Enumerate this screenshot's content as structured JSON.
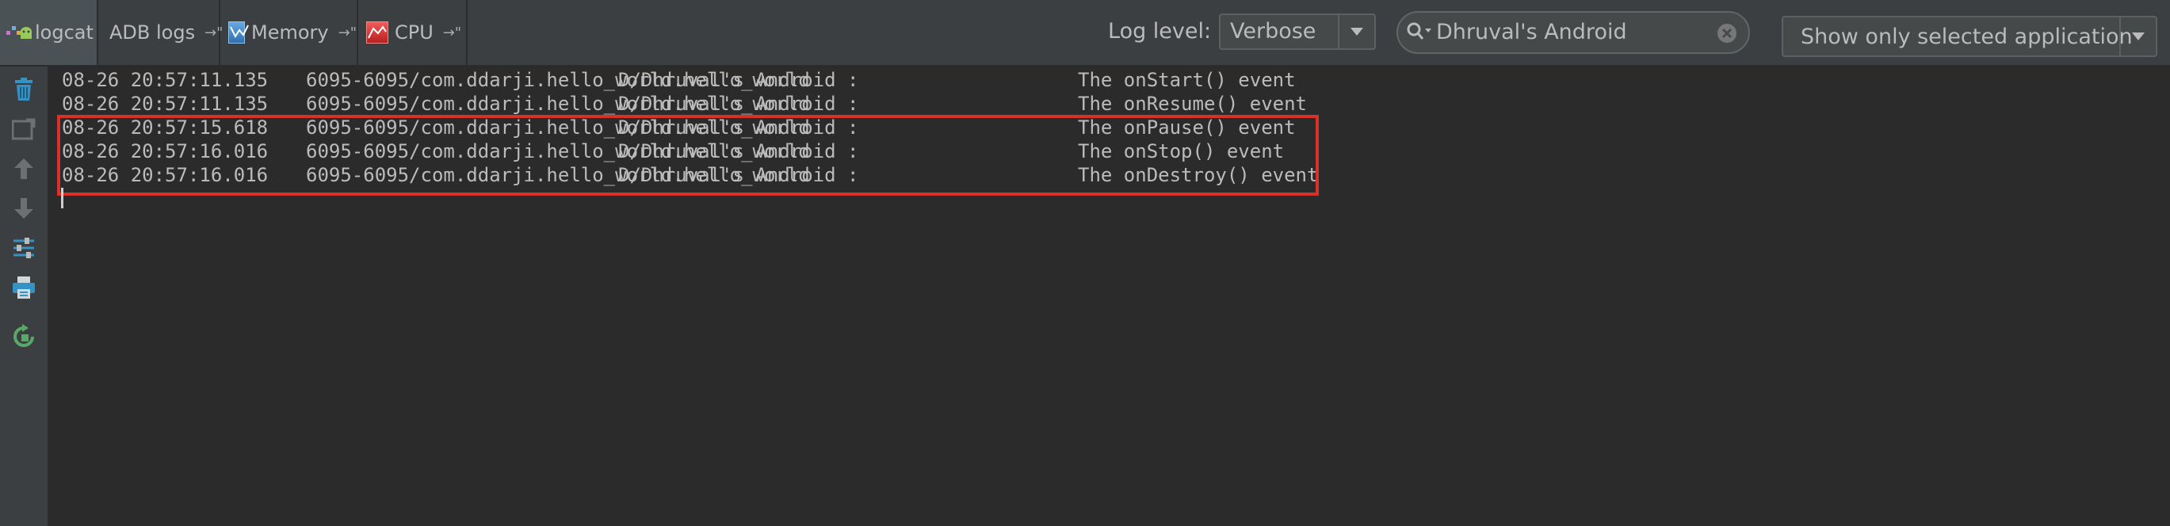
{
  "tabs": [
    {
      "label": "logcat",
      "active": true
    },
    {
      "label": "ADB logs",
      "pin": "→\""
    },
    {
      "label": "Memory",
      "pin": "→\""
    },
    {
      "label": "CPU",
      "pin": "→\""
    }
  ],
  "toolbar": {
    "log_level_label": "Log level:",
    "log_level_value": "Verbose",
    "search_value": "Dhruval's Android",
    "app_filter_value": "Show only selected application"
  },
  "log": {
    "lines": [
      {
        "time": "08-26 20:57:11.135",
        "pid": "6095-6095/com.ddarji.hello_world.hello_world",
        "tag": "D/Dhruval's Android :",
        "msg": "The onStart() event"
      },
      {
        "time": "08-26 20:57:11.135",
        "pid": "6095-6095/com.ddarji.hello_world.hello_world",
        "tag": "D/Dhruval's Android :",
        "msg": "The onResume() event"
      },
      {
        "time": "08-26 20:57:15.618",
        "pid": "6095-6095/com.ddarji.hello_world.hello_world",
        "tag": "D/Dhruval's Android :",
        "msg": "The onPause() event"
      },
      {
        "time": "08-26 20:57:16.016",
        "pid": "6095-6095/com.ddarji.hello_world.hello_world",
        "tag": "D/Dhruval's Android :",
        "msg": "The onStop() event"
      },
      {
        "time": "08-26 20:57:16.016",
        "pid": "6095-6095/com.ddarji.hello_world.hello_world",
        "tag": "D/Dhruval's Android :",
        "msg": "The onDestroy() event"
      }
    ],
    "highlight_color": "#d9302a"
  },
  "icons": {
    "sidebar": [
      "trash-icon",
      "restart-icon",
      "up-arrow-icon",
      "down-arrow-icon",
      "filter-settings-icon",
      "print-icon",
      "restart-green-icon"
    ],
    "toolbar": [
      "android-logcat-icon",
      "memory-icon",
      "cpu-icon",
      "search-icon",
      "clear-icon",
      "dropdown-arrow-icon"
    ]
  },
  "colors": {
    "background": "#2b2b2b",
    "toolbar": "#3c3f41",
    "text": "#bbbbbb",
    "accent_blue": "#3592c4",
    "accent_red": "#d9302a"
  }
}
